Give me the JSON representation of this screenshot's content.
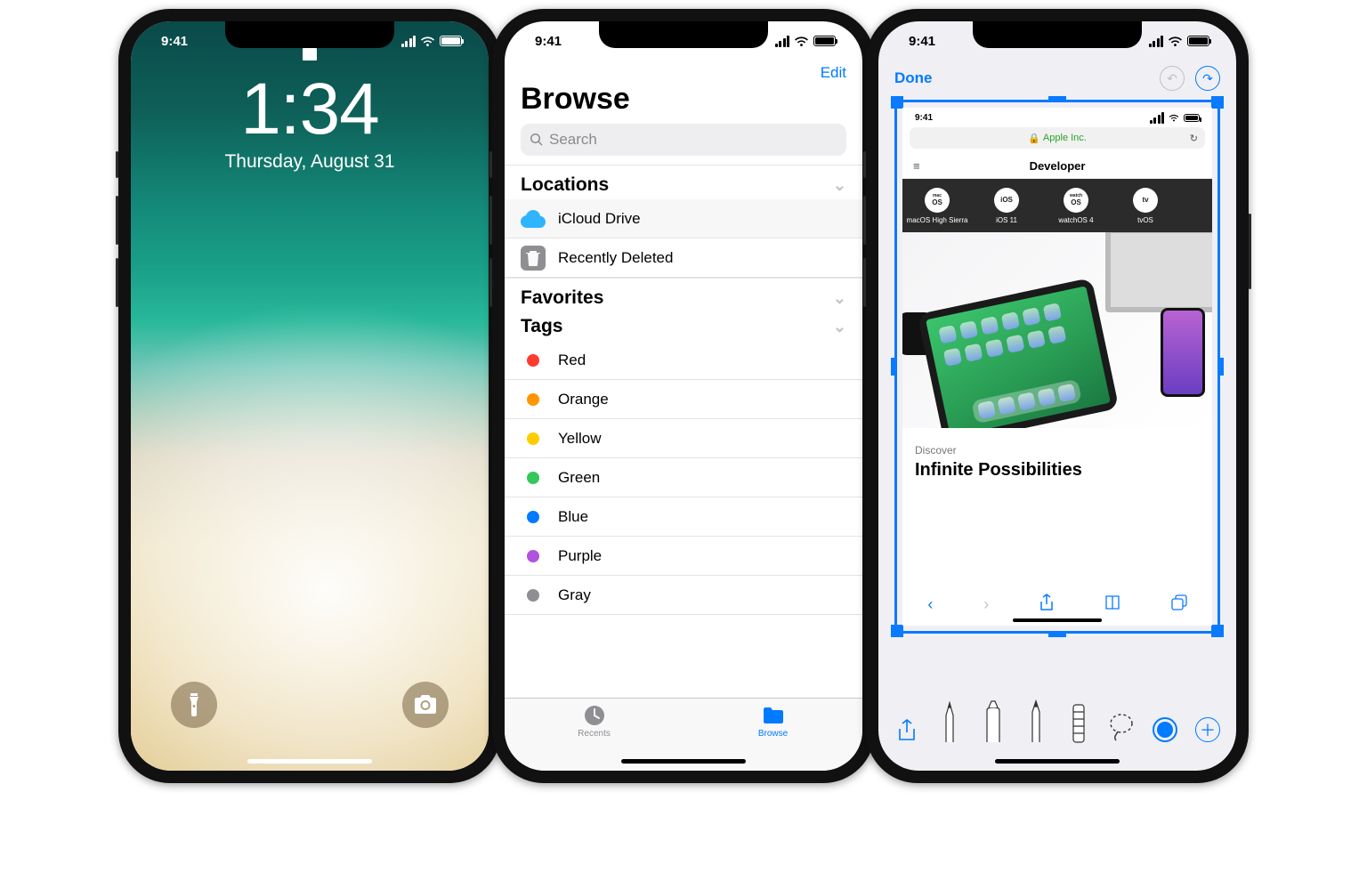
{
  "status_time": "9:41",
  "lock": {
    "time": "1:34",
    "date": "Thursday, August 31"
  },
  "files": {
    "edit": "Edit",
    "title": "Browse",
    "search_placeholder": "Search",
    "section_locations": "Locations",
    "section_favorites": "Favorites",
    "section_tags": "Tags",
    "locations": [
      {
        "label": "iCloud Drive"
      },
      {
        "label": "Recently Deleted"
      }
    ],
    "tags": [
      {
        "label": "Red",
        "color": "#ff3b30"
      },
      {
        "label": "Orange",
        "color": "#ff9500"
      },
      {
        "label": "Yellow",
        "color": "#ffcc00"
      },
      {
        "label": "Green",
        "color": "#34c759"
      },
      {
        "label": "Blue",
        "color": "#007aff"
      },
      {
        "label": "Purple",
        "color": "#af52de"
      },
      {
        "label": "Gray",
        "color": "#8e8e93"
      }
    ],
    "tabs": {
      "recents": "Recents",
      "browse": "Browse"
    }
  },
  "markup": {
    "done": "Done",
    "screenshot": {
      "status_time": "9:41",
      "url_label": "Apple Inc.",
      "dev_header": "Developer",
      "os_items": [
        "macOS High Sierra",
        "iOS 11",
        "watchOS 4",
        "tvOS"
      ],
      "os_short": [
        "OS",
        "iOS",
        "OS",
        "tv"
      ],
      "os_top": [
        "mac",
        "",
        "watch",
        ""
      ],
      "discover": "Discover",
      "headline": "Infinite Possibilities"
    }
  }
}
